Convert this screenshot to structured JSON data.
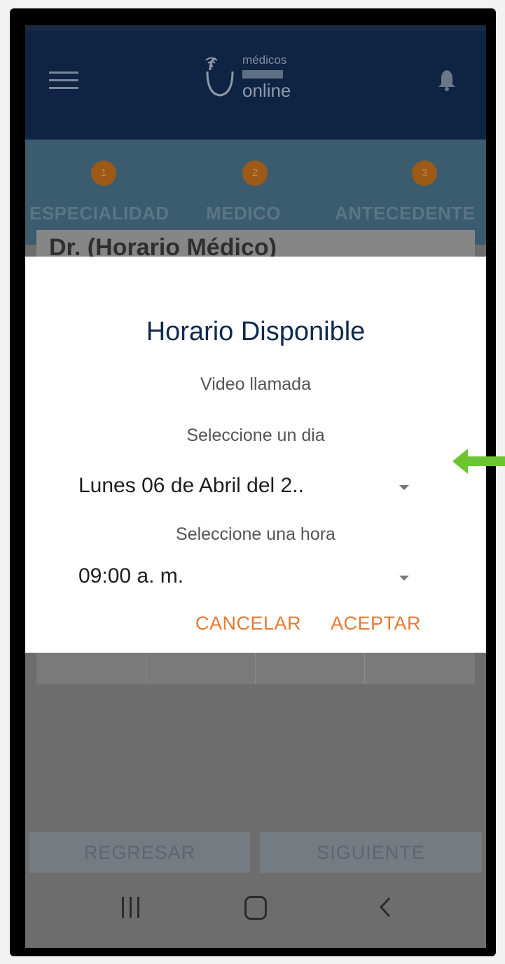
{
  "app": {
    "logo_line1": "médicos",
    "logo_line2": "online"
  },
  "steps": [
    {
      "number": "1",
      "label": "ESPECIALIDAD"
    },
    {
      "number": "2",
      "label": "MEDICO"
    },
    {
      "number": "3",
      "label": "ANTECEDENTE"
    }
  ],
  "background_card": {
    "title": "Dr. (Horario Médico)"
  },
  "dialog": {
    "title": "Horario Disponible",
    "call_type": "Video llamada",
    "day_prompt": "Seleccione un dia",
    "day_value": "Lunes 06 de Abril del 2..",
    "hour_prompt": "Seleccione una hora",
    "hour_value": "09:00 a. m.",
    "cancel_label": "CANCELAR",
    "accept_label": "ACEPTAR"
  },
  "footer": {
    "back_label": "REGRESAR",
    "next_label": "SIGUIENTE"
  },
  "colors": {
    "navy": "#0f2342",
    "accent_orange": "#e57a33",
    "annotation_green": "#6cc530"
  }
}
